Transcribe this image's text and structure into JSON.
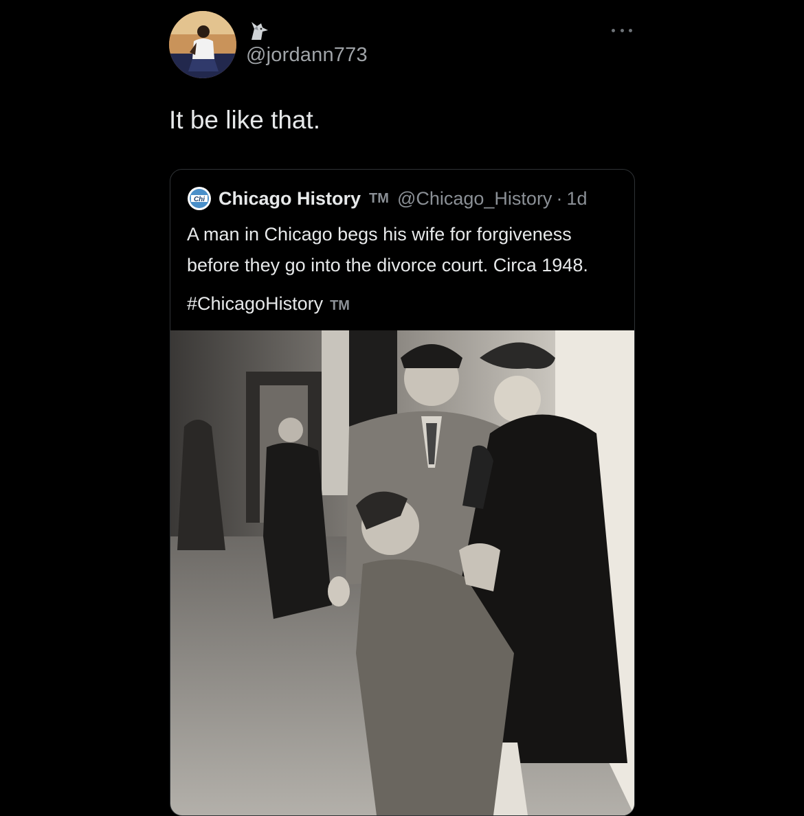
{
  "author": {
    "handle": "@jordann773",
    "avatar_icon": "profile-photo",
    "badge_icon": "wolf-icon"
  },
  "tweet": {
    "text": "It be like that."
  },
  "more_icon": "more-horizontal-icon",
  "quoted_tweet": {
    "logo_icon": "chicago-history-logo",
    "logo_text": "Chi",
    "display_name": "Chicago History",
    "tm_mark": "TM",
    "handle": "@Chicago_History",
    "separator": "·",
    "time": "1d",
    "body": "A man in Chicago begs his wife for forgiveness before they go into the divorce court. Circa 1948.",
    "hashtag": "#ChicagoHistory",
    "hashtag_tm": "TM",
    "photo_icon": "vintage-photo"
  },
  "colors": {
    "background": "#000000",
    "text_primary": "#e7e9ea",
    "text_secondary": "#8b9096",
    "border": "#2f3336"
  }
}
